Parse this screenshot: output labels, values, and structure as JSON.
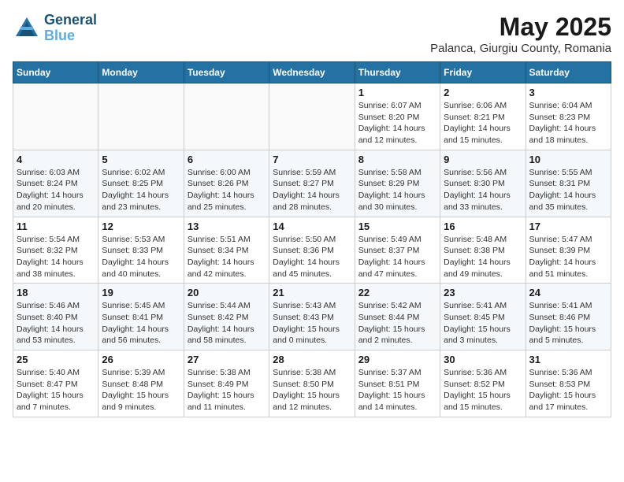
{
  "header": {
    "logo_line1": "General",
    "logo_line2": "Blue",
    "month_year": "May 2025",
    "location": "Palanca, Giurgiu County, Romania"
  },
  "weekdays": [
    "Sunday",
    "Monday",
    "Tuesday",
    "Wednesday",
    "Thursday",
    "Friday",
    "Saturday"
  ],
  "weeks": [
    [
      {
        "day": "",
        "info": ""
      },
      {
        "day": "",
        "info": ""
      },
      {
        "day": "",
        "info": ""
      },
      {
        "day": "",
        "info": ""
      },
      {
        "day": "1",
        "info": "Sunrise: 6:07 AM\nSunset: 8:20 PM\nDaylight: 14 hours\nand 12 minutes."
      },
      {
        "day": "2",
        "info": "Sunrise: 6:06 AM\nSunset: 8:21 PM\nDaylight: 14 hours\nand 15 minutes."
      },
      {
        "day": "3",
        "info": "Sunrise: 6:04 AM\nSunset: 8:23 PM\nDaylight: 14 hours\nand 18 minutes."
      }
    ],
    [
      {
        "day": "4",
        "info": "Sunrise: 6:03 AM\nSunset: 8:24 PM\nDaylight: 14 hours\nand 20 minutes."
      },
      {
        "day": "5",
        "info": "Sunrise: 6:02 AM\nSunset: 8:25 PM\nDaylight: 14 hours\nand 23 minutes."
      },
      {
        "day": "6",
        "info": "Sunrise: 6:00 AM\nSunset: 8:26 PM\nDaylight: 14 hours\nand 25 minutes."
      },
      {
        "day": "7",
        "info": "Sunrise: 5:59 AM\nSunset: 8:27 PM\nDaylight: 14 hours\nand 28 minutes."
      },
      {
        "day": "8",
        "info": "Sunrise: 5:58 AM\nSunset: 8:29 PM\nDaylight: 14 hours\nand 30 minutes."
      },
      {
        "day": "9",
        "info": "Sunrise: 5:56 AM\nSunset: 8:30 PM\nDaylight: 14 hours\nand 33 minutes."
      },
      {
        "day": "10",
        "info": "Sunrise: 5:55 AM\nSunset: 8:31 PM\nDaylight: 14 hours\nand 35 minutes."
      }
    ],
    [
      {
        "day": "11",
        "info": "Sunrise: 5:54 AM\nSunset: 8:32 PM\nDaylight: 14 hours\nand 38 minutes."
      },
      {
        "day": "12",
        "info": "Sunrise: 5:53 AM\nSunset: 8:33 PM\nDaylight: 14 hours\nand 40 minutes."
      },
      {
        "day": "13",
        "info": "Sunrise: 5:51 AM\nSunset: 8:34 PM\nDaylight: 14 hours\nand 42 minutes."
      },
      {
        "day": "14",
        "info": "Sunrise: 5:50 AM\nSunset: 8:36 PM\nDaylight: 14 hours\nand 45 minutes."
      },
      {
        "day": "15",
        "info": "Sunrise: 5:49 AM\nSunset: 8:37 PM\nDaylight: 14 hours\nand 47 minutes."
      },
      {
        "day": "16",
        "info": "Sunrise: 5:48 AM\nSunset: 8:38 PM\nDaylight: 14 hours\nand 49 minutes."
      },
      {
        "day": "17",
        "info": "Sunrise: 5:47 AM\nSunset: 8:39 PM\nDaylight: 14 hours\nand 51 minutes."
      }
    ],
    [
      {
        "day": "18",
        "info": "Sunrise: 5:46 AM\nSunset: 8:40 PM\nDaylight: 14 hours\nand 53 minutes."
      },
      {
        "day": "19",
        "info": "Sunrise: 5:45 AM\nSunset: 8:41 PM\nDaylight: 14 hours\nand 56 minutes."
      },
      {
        "day": "20",
        "info": "Sunrise: 5:44 AM\nSunset: 8:42 PM\nDaylight: 14 hours\nand 58 minutes."
      },
      {
        "day": "21",
        "info": "Sunrise: 5:43 AM\nSunset: 8:43 PM\nDaylight: 15 hours\nand 0 minutes."
      },
      {
        "day": "22",
        "info": "Sunrise: 5:42 AM\nSunset: 8:44 PM\nDaylight: 15 hours\nand 2 minutes."
      },
      {
        "day": "23",
        "info": "Sunrise: 5:41 AM\nSunset: 8:45 PM\nDaylight: 15 hours\nand 3 minutes."
      },
      {
        "day": "24",
        "info": "Sunrise: 5:41 AM\nSunset: 8:46 PM\nDaylight: 15 hours\nand 5 minutes."
      }
    ],
    [
      {
        "day": "25",
        "info": "Sunrise: 5:40 AM\nSunset: 8:47 PM\nDaylight: 15 hours\nand 7 minutes."
      },
      {
        "day": "26",
        "info": "Sunrise: 5:39 AM\nSunset: 8:48 PM\nDaylight: 15 hours\nand 9 minutes."
      },
      {
        "day": "27",
        "info": "Sunrise: 5:38 AM\nSunset: 8:49 PM\nDaylight: 15 hours\nand 11 minutes."
      },
      {
        "day": "28",
        "info": "Sunrise: 5:38 AM\nSunset: 8:50 PM\nDaylight: 15 hours\nand 12 minutes."
      },
      {
        "day": "29",
        "info": "Sunrise: 5:37 AM\nSunset: 8:51 PM\nDaylight: 15 hours\nand 14 minutes."
      },
      {
        "day": "30",
        "info": "Sunrise: 5:36 AM\nSunset: 8:52 PM\nDaylight: 15 hours\nand 15 minutes."
      },
      {
        "day": "31",
        "info": "Sunrise: 5:36 AM\nSunset: 8:53 PM\nDaylight: 15 hours\nand 17 minutes."
      }
    ]
  ]
}
